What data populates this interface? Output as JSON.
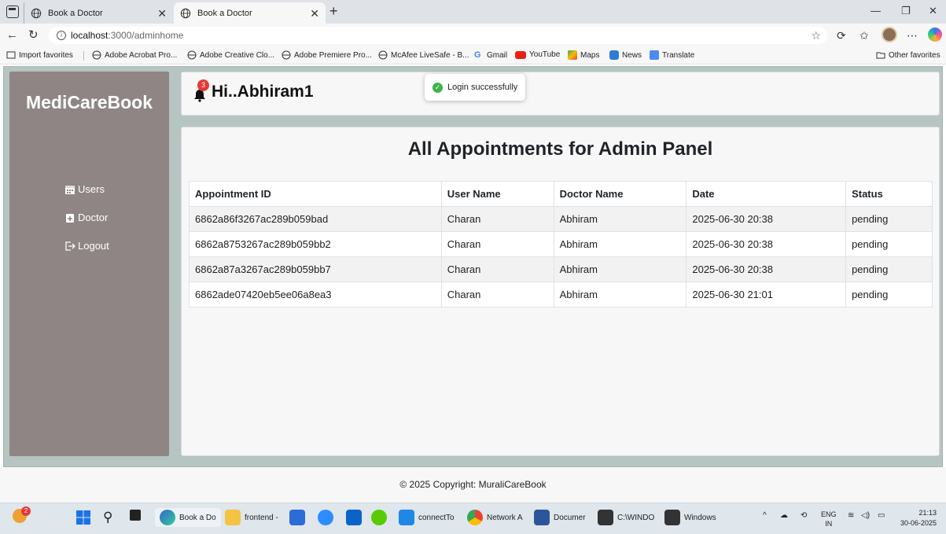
{
  "browser": {
    "tabs": [
      {
        "title": "Book a Doctor",
        "active": false
      },
      {
        "title": "Book a Doctor",
        "active": true
      }
    ],
    "url_host": "localhost",
    "url_path": ":3000/adminhome",
    "favorites": [
      {
        "label": "Import favorites"
      },
      {
        "label": "Adobe Acrobat Pro..."
      },
      {
        "label": "Adobe Creative Clo..."
      },
      {
        "label": "Adobe Premiere Pro..."
      },
      {
        "label": "McAfee LiveSafe - B..."
      },
      {
        "label": "Gmail"
      },
      {
        "label": "YouTube"
      },
      {
        "label": "Maps"
      },
      {
        "label": "News"
      },
      {
        "label": "Translate"
      }
    ],
    "other_favorites": "Other favorites"
  },
  "sidebar": {
    "brand": "MediCareBook",
    "items": [
      {
        "label": "Users",
        "icon": "calendar-icon"
      },
      {
        "label": "Doctor",
        "icon": "doctor-icon"
      },
      {
        "label": "Logout",
        "icon": "logout-icon"
      }
    ]
  },
  "header": {
    "greeting": "Hi..Abhiram1",
    "notification_count": "3",
    "toast": "Login successfully"
  },
  "main": {
    "title": "All Appointments for Admin Panel",
    "columns": [
      "Appointment ID",
      "User Name",
      "Doctor Name",
      "Date",
      "Status"
    ],
    "rows": [
      [
        "6862a86f3267ac289b059bad",
        "Charan",
        "Abhiram",
        "2025-06-30 20:38",
        "pending"
      ],
      [
        "6862a8753267ac289b059bb2",
        "Charan",
        "Abhiram",
        "2025-06-30 20:38",
        "pending"
      ],
      [
        "6862a87a3267ac289b059bb7",
        "Charan",
        "Abhiram",
        "2025-06-30 20:38",
        "pending"
      ],
      [
        "6862ade07420eb5ee06a8ea3",
        "Charan",
        "Abhiram",
        "2025-06-30 21:01",
        "pending"
      ]
    ]
  },
  "footer": "© 2025 Copyright: MuraliCareBook",
  "taskbar": {
    "notification_count": "2",
    "apps": [
      {
        "label": "Book a Do"
      },
      {
        "label": "frontend -"
      },
      {
        "label": "connectTo"
      },
      {
        "label": "Network A"
      },
      {
        "label": "Documer"
      },
      {
        "label": "C:\\WINDO"
      },
      {
        "label": "Windows"
      }
    ],
    "lang_top": "ENG",
    "lang_bottom": "IN",
    "time": "21:13",
    "date": "30-06-2025"
  },
  "colors": {
    "sidebar": "#8f8585",
    "app_background": "#b6c4c2",
    "badge": "#e53935",
    "toast_check": "#3bb54a"
  }
}
